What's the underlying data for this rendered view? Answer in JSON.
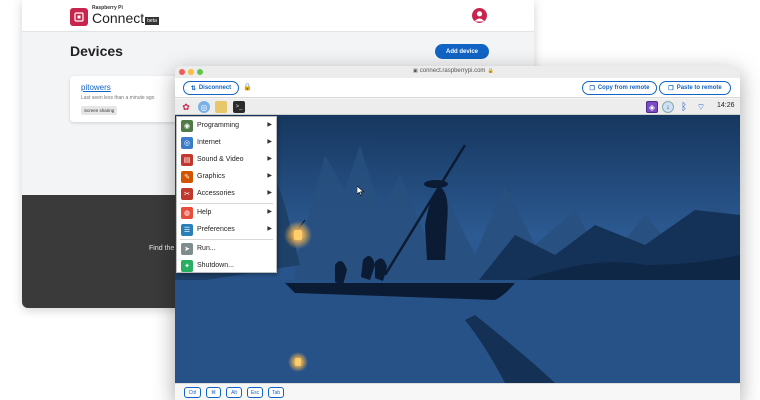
{
  "dashboard": {
    "brand_small": "Raspberry Pi",
    "brand_big": "Connect",
    "brand_badge": "beta",
    "page_title": "Devices",
    "add_device_label": "Add device",
    "device": {
      "name": "pitowers",
      "last_seen": "Last seen less than a minute ago",
      "badge": "Screen sharing"
    },
    "find_text": "Find the"
  },
  "browser": {
    "url": "connect.raspberrypi.com",
    "disconnect_label": "Disconnect",
    "copy_label": "Copy from remote",
    "paste_label": "Paste to remote"
  },
  "taskbar": {
    "clock": "14:26",
    "launcher_icons": [
      "raspberry-icon",
      "globe-icon",
      "folder-icon",
      "terminal-icon"
    ],
    "tray_icons": [
      "connect-tray-icon",
      "update-icon",
      "bluetooth-icon",
      "wifi-icon"
    ]
  },
  "menu": {
    "items": [
      {
        "label": "Programming",
        "icon": "programming-icon",
        "color": "#4e7a45",
        "submenu": true
      },
      {
        "label": "Internet",
        "icon": "internet-icon",
        "color": "#3b7cc9",
        "submenu": true
      },
      {
        "label": "Sound & Video",
        "icon": "sound-video-icon",
        "color": "#c0392b",
        "submenu": true
      },
      {
        "label": "Graphics",
        "icon": "graphics-icon",
        "color": "#d35400",
        "submenu": true
      },
      {
        "label": "Accessories",
        "icon": "accessories-icon",
        "color": "#c0392b",
        "submenu": true
      },
      {
        "label": "Help",
        "icon": "help-icon",
        "color": "#e74c3c",
        "submenu": true
      },
      {
        "label": "Preferences",
        "icon": "preferences-icon",
        "color": "#2980b9",
        "submenu": true
      },
      {
        "label": "Run...",
        "icon": "run-icon",
        "color": "#7f8c8d",
        "submenu": false
      },
      {
        "label": "Shutdown...",
        "icon": "shutdown-icon",
        "color": "#27ae60",
        "submenu": false
      }
    ]
  },
  "keys": [
    "Ctrl",
    "⌘",
    "Alt",
    "Esc",
    "Tab"
  ]
}
